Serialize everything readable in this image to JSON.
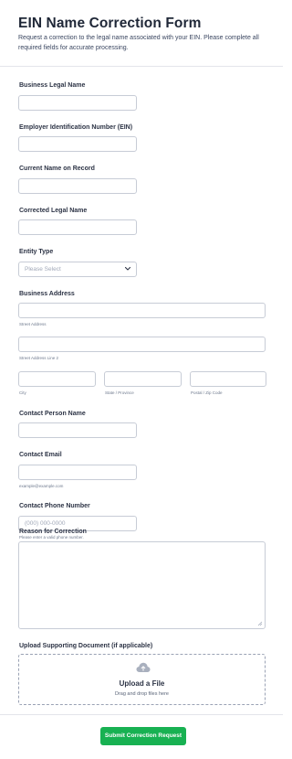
{
  "form": {
    "title": "EIN Name Correction Form",
    "subtitle": "Request a correction to the legal name associated with your EIN. Please complete all required fields for accurate processing."
  },
  "fields": {
    "business_legal_name": {
      "label": "Business Legal Name",
      "value": ""
    },
    "ein": {
      "label": "Employer Identification Number (EIN)",
      "value": ""
    },
    "current_name": {
      "label": "Current Name on Record",
      "value": ""
    },
    "corrected_name": {
      "label": "Corrected Legal Name",
      "value": ""
    },
    "entity_type": {
      "label": "Entity Type",
      "selected": "Please Select"
    },
    "business_address": {
      "label": "Business Address",
      "street_sublabel": "Street Address",
      "street2_sublabel": "Street Address Line 2",
      "city_sublabel": "City",
      "state_sublabel": "State / Province",
      "zip_sublabel": "Postal / Zip Code"
    },
    "contact_name": {
      "label": "Contact Person Name",
      "value": ""
    },
    "contact_email": {
      "label": "Contact Email",
      "sublabel": "example@example.com",
      "value": ""
    },
    "contact_phone": {
      "label": "Contact Phone Number",
      "placeholder": "(000) 000-0000",
      "sublabel": "Please enter a valid phone number."
    },
    "reason": {
      "label": "Reason for Correction",
      "value": ""
    },
    "upload": {
      "label": "Upload Supporting Document (if applicable)",
      "title": "Upload a File",
      "subtitle": "Drag and drop files here",
      "icon": "cloud-upload-icon"
    }
  },
  "actions": {
    "submit_label": "Submit Correction Request"
  },
  "colors": {
    "submit": "#18b152",
    "border": "#c7ccd6",
    "text": "#2c3345"
  }
}
